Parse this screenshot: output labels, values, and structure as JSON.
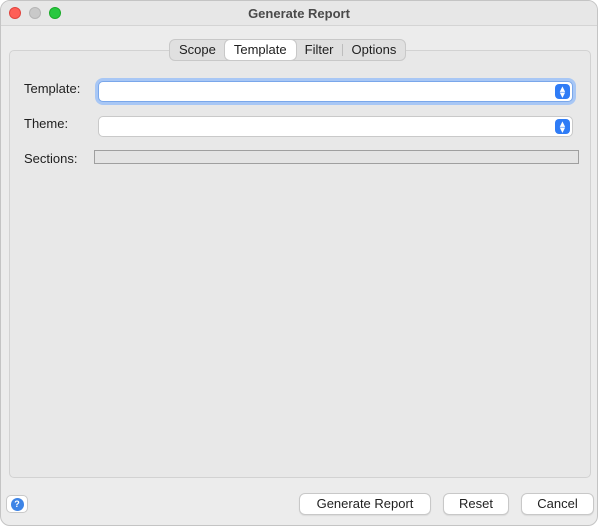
{
  "window": {
    "title": "Generate Report"
  },
  "tabs": [
    {
      "label": "Scope"
    },
    {
      "label": "Template"
    },
    {
      "label": "Filter"
    },
    {
      "label": "Options"
    }
  ],
  "active_tab": "Template",
  "form": {
    "template": {
      "label": "Template:",
      "value": ""
    },
    "theme": {
      "label": "Theme:",
      "value": ""
    },
    "sections": {
      "label": "Sections:"
    }
  },
  "footer": {
    "help_icon": "question-mark-icon",
    "generate_label": "Generate Report",
    "reset_label": "Reset",
    "cancel_label": "Cancel"
  },
  "colors": {
    "accent": "#2f7cf6",
    "focus_ring": "#a8c7f5",
    "close": "#fe5f57",
    "minimize": "#c9c9c9",
    "maximize": "#28c840"
  }
}
